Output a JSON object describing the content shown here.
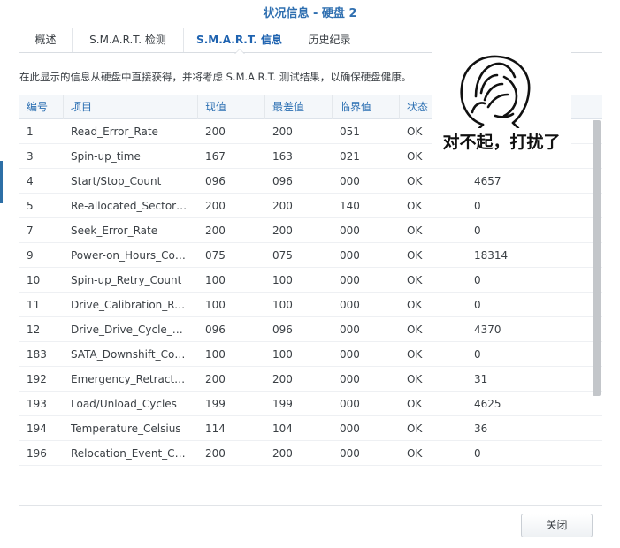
{
  "window": {
    "title": "状况信息 - 硬盘 2"
  },
  "tabs": [
    {
      "label": "概述",
      "active": false
    },
    {
      "label": "S.M.A.R.T. 检测",
      "active": false
    },
    {
      "label": "S.M.A.R.T. 信息",
      "active": true
    },
    {
      "label": "历史纪录",
      "active": false
    }
  ],
  "description": "在此显示的信息从硬盘中直接获得，并将考虑 S.M.A.R.T. 测试结果，以确保硬盘健康。",
  "table": {
    "columns": [
      "编号",
      "项目",
      "现值",
      "最差值",
      "临界值",
      "状态"
    ],
    "rows": [
      [
        "1",
        "Read_Error_Rate",
        "200",
        "200",
        "051",
        "OK",
        ""
      ],
      [
        "3",
        "Spin-up_time",
        "167",
        "163",
        "021",
        "OK",
        ""
      ],
      [
        "4",
        "Start/Stop_Count",
        "096",
        "096",
        "000",
        "OK",
        "4657"
      ],
      [
        "5",
        "Re-allocated_Sector_Count",
        "200",
        "200",
        "140",
        "OK",
        "0"
      ],
      [
        "7",
        "Seek_Error_Rate",
        "200",
        "200",
        "000",
        "OK",
        "0"
      ],
      [
        "9",
        "Power-on_Hours_Count",
        "075",
        "075",
        "000",
        "OK",
        "18314"
      ],
      [
        "10",
        "Spin-up_Retry_Count",
        "100",
        "100",
        "000",
        "OK",
        "0"
      ],
      [
        "11",
        "Drive_Calibration_Retry_Count",
        "100",
        "100",
        "000",
        "OK",
        "0"
      ],
      [
        "12",
        "Drive_Drive_Cycle_Count",
        "096",
        "096",
        "000",
        "OK",
        "4370"
      ],
      [
        "183",
        "SATA_Downshift_Count",
        "100",
        "100",
        "000",
        "OK",
        "0"
      ],
      [
        "192",
        "Emergency_Retract_Count",
        "200",
        "200",
        "000",
        "OK",
        "31"
      ],
      [
        "193",
        "Load/Unload_Cycles",
        "199",
        "199",
        "000",
        "OK",
        "4625"
      ],
      [
        "194",
        "Temperature_Celsius",
        "114",
        "104",
        "000",
        "OK",
        "36"
      ],
      [
        "196",
        "Relocation_Event_Count",
        "200",
        "200",
        "000",
        "OK",
        "0"
      ]
    ]
  },
  "meme": {
    "caption": "对不起，打扰了"
  },
  "footer": {
    "close_label": "关闭"
  },
  "colors": {
    "accent": "#2f6fb0",
    "header_text": "#2b6fb2"
  }
}
